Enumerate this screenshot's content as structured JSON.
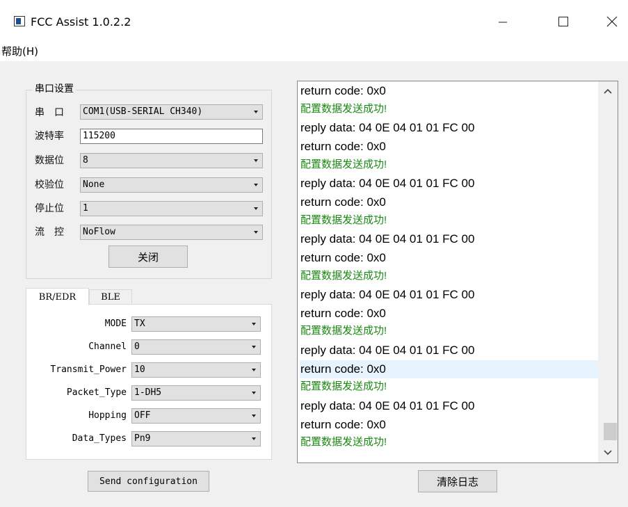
{
  "window": {
    "title": "FCC Assist 1.0.2.2",
    "icon": "app-window-icon",
    "controls": [
      "minimize-icon",
      "maximize-icon",
      "close-icon"
    ]
  },
  "menu": {
    "help": "帮助(H)"
  },
  "serial": {
    "group_title": "串口设置",
    "port_label": "串　口",
    "port_value": "COM1(USB-SERIAL CH340)",
    "baud_label": "波特率",
    "baud_value": "115200",
    "databits_label": "数据位",
    "databits_value": "8",
    "parity_label": "校验位",
    "parity_value": "None",
    "stopbits_label": "停止位",
    "stopbits_value": "1",
    "flow_label": "流　控",
    "flow_value": "NoFlow",
    "close_button": "关闭"
  },
  "tabs": [
    {
      "label": "BR/EDR",
      "active": true
    },
    {
      "label": "BLE",
      "active": false
    }
  ],
  "params": {
    "mode_label": "MODE",
    "mode_value": "TX",
    "channel_label": "Channel",
    "channel_value": "0",
    "power_label": "Transmit_Power",
    "power_value": "10",
    "packet_label": "Packet_Type",
    "packet_value": "1-DH5",
    "hopping_label": "Hopping",
    "hopping_value": "OFF",
    "datatypes_label": "Data_Types",
    "datatypes_value": "Pn9"
  },
  "send_button": "Send configuration",
  "clear_button": "清除日志",
  "log": [
    {
      "text": "return code: 0x0",
      "color": "black",
      "highlight": false
    },
    {
      "text": "配置数据发送成功!",
      "color": "green",
      "highlight": false
    },
    {
      "text": "reply data: 04 0E 04 01 01 FC 00",
      "color": "black",
      "highlight": false
    },
    {
      "text": "return code: 0x0",
      "color": "black",
      "highlight": false
    },
    {
      "text": "配置数据发送成功!",
      "color": "green",
      "highlight": false
    },
    {
      "text": "reply data: 04 0E 04 01 01 FC 00",
      "color": "black",
      "highlight": false
    },
    {
      "text": "return code: 0x0",
      "color": "black",
      "highlight": false
    },
    {
      "text": "配置数据发送成功!",
      "color": "green",
      "highlight": false
    },
    {
      "text": "reply data: 04 0E 04 01 01 FC 00",
      "color": "black",
      "highlight": false
    },
    {
      "text": "return code: 0x0",
      "color": "black",
      "highlight": false
    },
    {
      "text": "配置数据发送成功!",
      "color": "green",
      "highlight": false
    },
    {
      "text": "reply data: 04 0E 04 01 01 FC 00",
      "color": "black",
      "highlight": false
    },
    {
      "text": "return code: 0x0",
      "color": "black",
      "highlight": false
    },
    {
      "text": "配置数据发送成功!",
      "color": "green",
      "highlight": false
    },
    {
      "text": "reply data: 04 0E 04 01 01 FC 00",
      "color": "black",
      "highlight": false
    },
    {
      "text": "return code: 0x0",
      "color": "black",
      "highlight": true
    },
    {
      "text": "配置数据发送成功!",
      "color": "green",
      "highlight": false
    },
    {
      "text": "reply data: 04 0E 04 01 01 FC 00",
      "color": "black",
      "highlight": false
    },
    {
      "text": "return code: 0x0",
      "color": "black",
      "highlight": false
    },
    {
      "text": "配置数据发送成功!",
      "color": "green",
      "highlight": false
    }
  ],
  "scroll": {
    "up": "chevron-up-icon",
    "down": "chevron-down-icon",
    "position": 0.97
  },
  "colors": {
    "log_success": "#1a8a12",
    "log_highlight": "#e6f2fc",
    "window_bg": "#f0f0f0"
  }
}
